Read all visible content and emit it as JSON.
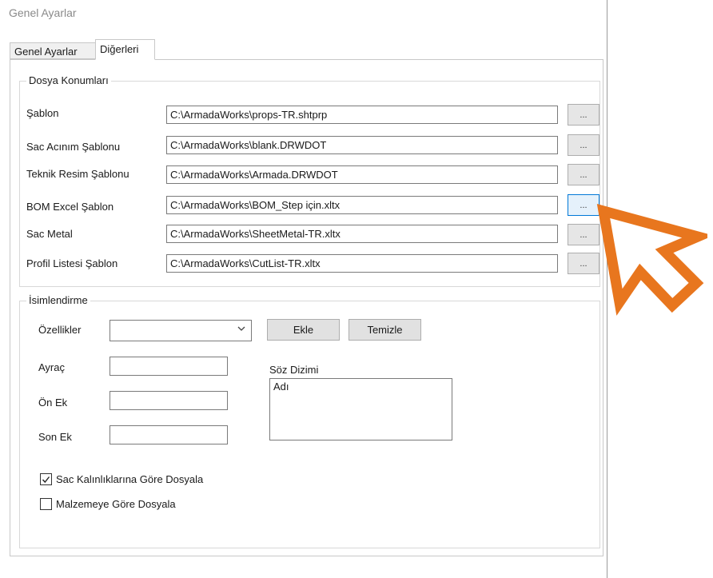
{
  "window": {
    "title": "Genel Ayarlar"
  },
  "tabs": [
    {
      "label": "Genel Ayarlar"
    },
    {
      "label": "Diğerleri",
      "active": true
    }
  ],
  "dosya": {
    "legend": "Dosya Konumları",
    "browse_label": "...",
    "rows": [
      {
        "label": "Şablon",
        "path": "C:\\ArmadaWorks\\props-TR.shtprp"
      },
      {
        "label": "Sac Acınım Şablonu",
        "path": "C:\\ArmadaWorks\\blank.DRWDOT"
      },
      {
        "label": "Teknik Resim Şablonu",
        "path": "C:\\ArmadaWorks\\Armada.DRWDOT"
      },
      {
        "label": "BOM  Excel Şablon",
        "path": "C:\\ArmadaWorks\\BOM_Step için.xltx"
      },
      {
        "label": "Sac Metal",
        "path": "C:\\ArmadaWorks\\SheetMetal-TR.xltx"
      },
      {
        "label": "Profil Listesi Şablon",
        "path": "C:\\ArmadaWorks\\CutList-TR.xltx"
      }
    ]
  },
  "isim": {
    "legend": "İsimlendirme",
    "ozellikler_label": "Özellikler",
    "ozellikler_value": "",
    "ekle_label": "Ekle",
    "temizle_label": "Temizle",
    "ayrac_label": "Ayraç",
    "ayrac_value": "",
    "onek_label": "Ön Ek",
    "onek_value": "",
    "sonek_label": "Son Ek",
    "sonek_value": "",
    "syntax_label": "Söz Dizimi",
    "syntax_value": "Adı",
    "check1_label": "Sac Kalınlıklarına Göre Dosyala",
    "check1_checked": true,
    "check2_label": "Malzemeye Göre Dosyala",
    "check2_checked": false
  },
  "colors": {
    "cursor": "#e8761e",
    "accent": "#0078d7"
  }
}
